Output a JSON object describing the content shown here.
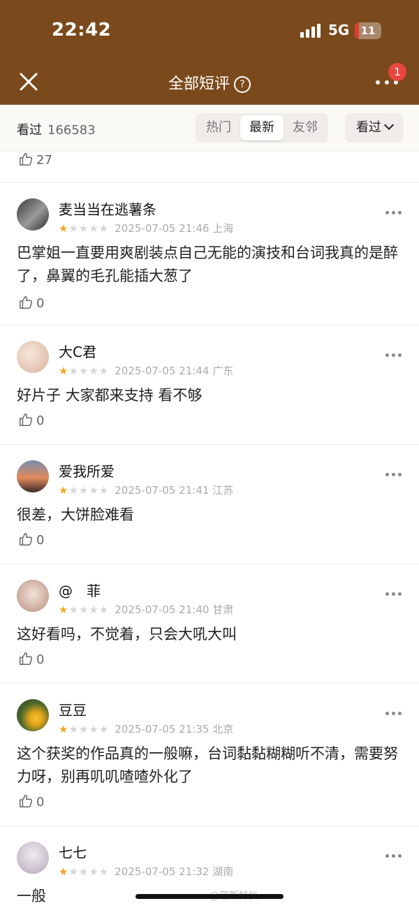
{
  "status": {
    "time": "22:42",
    "network": "5G",
    "battery": "11"
  },
  "nav": {
    "title": "全部短评",
    "help_icon": "question-circle-icon",
    "badge": "1"
  },
  "filter": {
    "seen_label": "看过",
    "seen_count": "166583",
    "tabs": [
      {
        "label": "热门",
        "active": false
      },
      {
        "label": "最新",
        "active": true
      },
      {
        "label": "友邻",
        "active": false
      }
    ],
    "dropdown_label": "看过"
  },
  "prev_likes": "27",
  "reviews": [
    {
      "name": "麦当当在逃薯条",
      "stars": 1,
      "date": "2025-07-05 21:46",
      "location": "上海",
      "text": "巴掌姐一直要用爽剧装点自己无能的演技和台词我真的是醉了，鼻翼的毛孔能插大葱了",
      "likes": "0",
      "avatar_color": "#6b6b6b"
    },
    {
      "name": "大C君",
      "stars": 1,
      "date": "2025-07-05 21:44",
      "location": "广东",
      "text": "好片子 大家都来支持 看不够",
      "likes": "0",
      "avatar_color": "#e8d2c2"
    },
    {
      "name": "爱我所爱",
      "stars": 1,
      "date": "2025-07-05 21:41",
      "location": "江苏",
      "text": "很差，大饼脸难看",
      "likes": "0",
      "avatar_color": "#b0573e"
    },
    {
      "name": "@　菲",
      "stars": 1,
      "date": "2025-07-05 21:40",
      "location": "甘肃",
      "text": "这好看吗，不觉着，只会大吼大叫",
      "likes": "0",
      "avatar_color": "#d9c3b6"
    },
    {
      "name": "豆豆",
      "stars": 1,
      "date": "2025-07-05 21:35",
      "location": "北京",
      "text": "这个获奖的作品真的一般嘛，台词黏黏糊糊听不清，需要努力呀，别再叽叽喳喳外化了",
      "likes": "0",
      "avatar_color": "#6f7f3e"
    },
    {
      "name": "七七",
      "stars": 1,
      "date": "2025-07-05 21:32",
      "location": "湖南",
      "text": "一般",
      "likes": "",
      "avatar_color": "#c9c0cc"
    }
  ],
  "watermark": "@密斯特扒"
}
